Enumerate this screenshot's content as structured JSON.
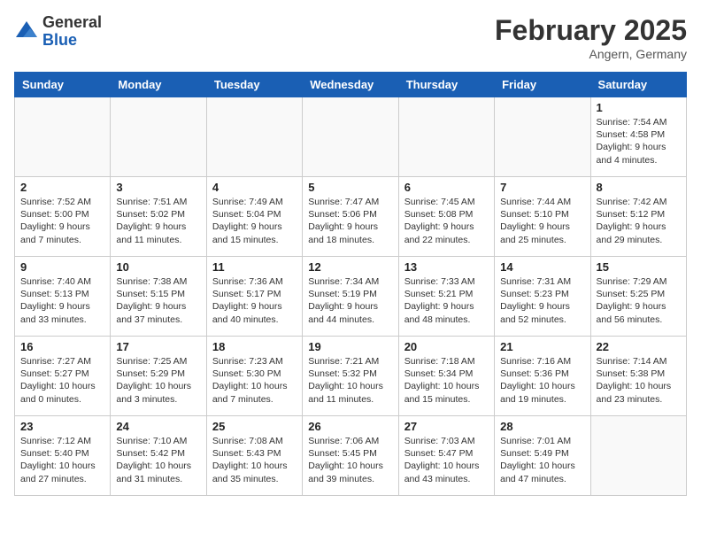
{
  "logo": {
    "general": "General",
    "blue": "Blue"
  },
  "title": {
    "main": "February 2025",
    "sub": "Angern, Germany"
  },
  "headers": [
    "Sunday",
    "Monday",
    "Tuesday",
    "Wednesday",
    "Thursday",
    "Friday",
    "Saturday"
  ],
  "weeks": [
    [
      {
        "day": "",
        "info": ""
      },
      {
        "day": "",
        "info": ""
      },
      {
        "day": "",
        "info": ""
      },
      {
        "day": "",
        "info": ""
      },
      {
        "day": "",
        "info": ""
      },
      {
        "day": "",
        "info": ""
      },
      {
        "day": "1",
        "info": "Sunrise: 7:54 AM\nSunset: 4:58 PM\nDaylight: 9 hours and 4 minutes."
      }
    ],
    [
      {
        "day": "2",
        "info": "Sunrise: 7:52 AM\nSunset: 5:00 PM\nDaylight: 9 hours and 7 minutes."
      },
      {
        "day": "3",
        "info": "Sunrise: 7:51 AM\nSunset: 5:02 PM\nDaylight: 9 hours and 11 minutes."
      },
      {
        "day": "4",
        "info": "Sunrise: 7:49 AM\nSunset: 5:04 PM\nDaylight: 9 hours and 15 minutes."
      },
      {
        "day": "5",
        "info": "Sunrise: 7:47 AM\nSunset: 5:06 PM\nDaylight: 9 hours and 18 minutes."
      },
      {
        "day": "6",
        "info": "Sunrise: 7:45 AM\nSunset: 5:08 PM\nDaylight: 9 hours and 22 minutes."
      },
      {
        "day": "7",
        "info": "Sunrise: 7:44 AM\nSunset: 5:10 PM\nDaylight: 9 hours and 25 minutes."
      },
      {
        "day": "8",
        "info": "Sunrise: 7:42 AM\nSunset: 5:12 PM\nDaylight: 9 hours and 29 minutes."
      }
    ],
    [
      {
        "day": "9",
        "info": "Sunrise: 7:40 AM\nSunset: 5:13 PM\nDaylight: 9 hours and 33 minutes."
      },
      {
        "day": "10",
        "info": "Sunrise: 7:38 AM\nSunset: 5:15 PM\nDaylight: 9 hours and 37 minutes."
      },
      {
        "day": "11",
        "info": "Sunrise: 7:36 AM\nSunset: 5:17 PM\nDaylight: 9 hours and 40 minutes."
      },
      {
        "day": "12",
        "info": "Sunrise: 7:34 AM\nSunset: 5:19 PM\nDaylight: 9 hours and 44 minutes."
      },
      {
        "day": "13",
        "info": "Sunrise: 7:33 AM\nSunset: 5:21 PM\nDaylight: 9 hours and 48 minutes."
      },
      {
        "day": "14",
        "info": "Sunrise: 7:31 AM\nSunset: 5:23 PM\nDaylight: 9 hours and 52 minutes."
      },
      {
        "day": "15",
        "info": "Sunrise: 7:29 AM\nSunset: 5:25 PM\nDaylight: 9 hours and 56 minutes."
      }
    ],
    [
      {
        "day": "16",
        "info": "Sunrise: 7:27 AM\nSunset: 5:27 PM\nDaylight: 10 hours and 0 minutes."
      },
      {
        "day": "17",
        "info": "Sunrise: 7:25 AM\nSunset: 5:29 PM\nDaylight: 10 hours and 3 minutes."
      },
      {
        "day": "18",
        "info": "Sunrise: 7:23 AM\nSunset: 5:30 PM\nDaylight: 10 hours and 7 minutes."
      },
      {
        "day": "19",
        "info": "Sunrise: 7:21 AM\nSunset: 5:32 PM\nDaylight: 10 hours and 11 minutes."
      },
      {
        "day": "20",
        "info": "Sunrise: 7:18 AM\nSunset: 5:34 PM\nDaylight: 10 hours and 15 minutes."
      },
      {
        "day": "21",
        "info": "Sunrise: 7:16 AM\nSunset: 5:36 PM\nDaylight: 10 hours and 19 minutes."
      },
      {
        "day": "22",
        "info": "Sunrise: 7:14 AM\nSunset: 5:38 PM\nDaylight: 10 hours and 23 minutes."
      }
    ],
    [
      {
        "day": "23",
        "info": "Sunrise: 7:12 AM\nSunset: 5:40 PM\nDaylight: 10 hours and 27 minutes."
      },
      {
        "day": "24",
        "info": "Sunrise: 7:10 AM\nSunset: 5:42 PM\nDaylight: 10 hours and 31 minutes."
      },
      {
        "day": "25",
        "info": "Sunrise: 7:08 AM\nSunset: 5:43 PM\nDaylight: 10 hours and 35 minutes."
      },
      {
        "day": "26",
        "info": "Sunrise: 7:06 AM\nSunset: 5:45 PM\nDaylight: 10 hours and 39 minutes."
      },
      {
        "day": "27",
        "info": "Sunrise: 7:03 AM\nSunset: 5:47 PM\nDaylight: 10 hours and 43 minutes."
      },
      {
        "day": "28",
        "info": "Sunrise: 7:01 AM\nSunset: 5:49 PM\nDaylight: 10 hours and 47 minutes."
      },
      {
        "day": "",
        "info": ""
      }
    ]
  ]
}
